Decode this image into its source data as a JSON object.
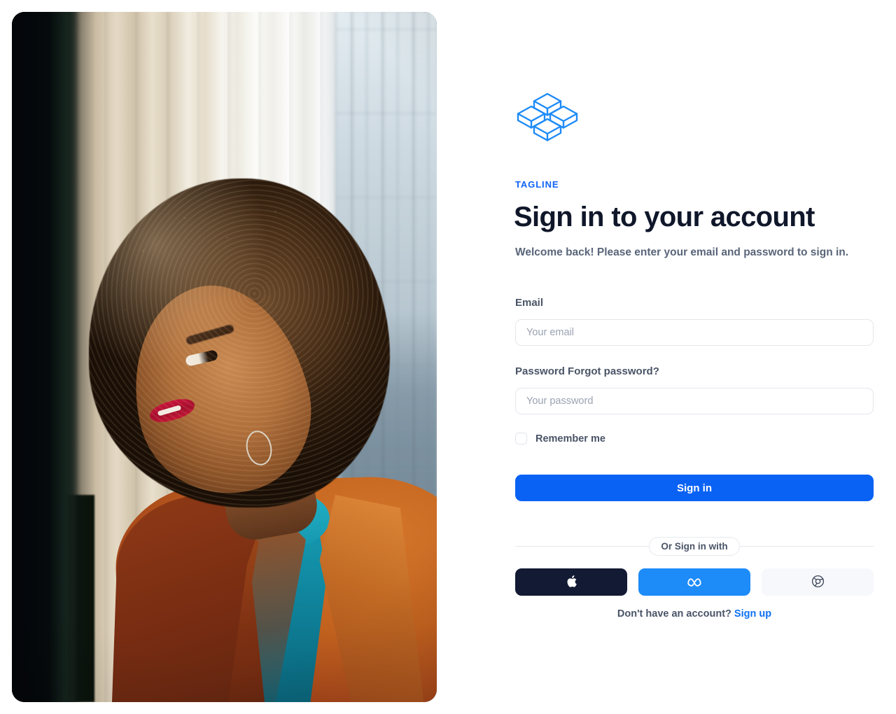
{
  "brand": {
    "logo_icon": "isometric-cubes-logo",
    "logo_color": "#1d8bf8",
    "tagline": "TAGLINE"
  },
  "heading": {
    "title": "Sign in to your account",
    "subtitle": "Welcome back! Please enter your email and password to sign in."
  },
  "form": {
    "email": {
      "label": "Email",
      "placeholder": "Your email",
      "value": ""
    },
    "password": {
      "label": "Password Forgot password?",
      "label_main": "Password",
      "forgot_link": "Forgot password?",
      "placeholder": "Your password",
      "value": ""
    },
    "remember": {
      "label": "Remember me",
      "checked": false
    },
    "submit_label": "Sign in"
  },
  "divider": {
    "label": "Or Sign in with"
  },
  "social": [
    {
      "name": "apple",
      "icon": "apple-icon",
      "bg": "#131a33",
      "fg": "#ffffff"
    },
    {
      "name": "meta",
      "icon": "meta-icon",
      "bg": "#1d8bf8",
      "fg": "#ffffff"
    },
    {
      "name": "google",
      "icon": "chrome-icon",
      "bg": "#f6f8fb",
      "fg": "#3a4358"
    }
  ],
  "footer": {
    "prompt": "Don't have an account?",
    "link": "Sign up"
  },
  "colors": {
    "accent": "#0a62f4",
    "tagline": "#1063f5",
    "title": "#10172a",
    "muted": "#4a5467",
    "border": "#e3e6ec"
  },
  "hero_image": {
    "alt": "Woman with afro hair in orange blazer and teal turtleneck looking out a window"
  }
}
